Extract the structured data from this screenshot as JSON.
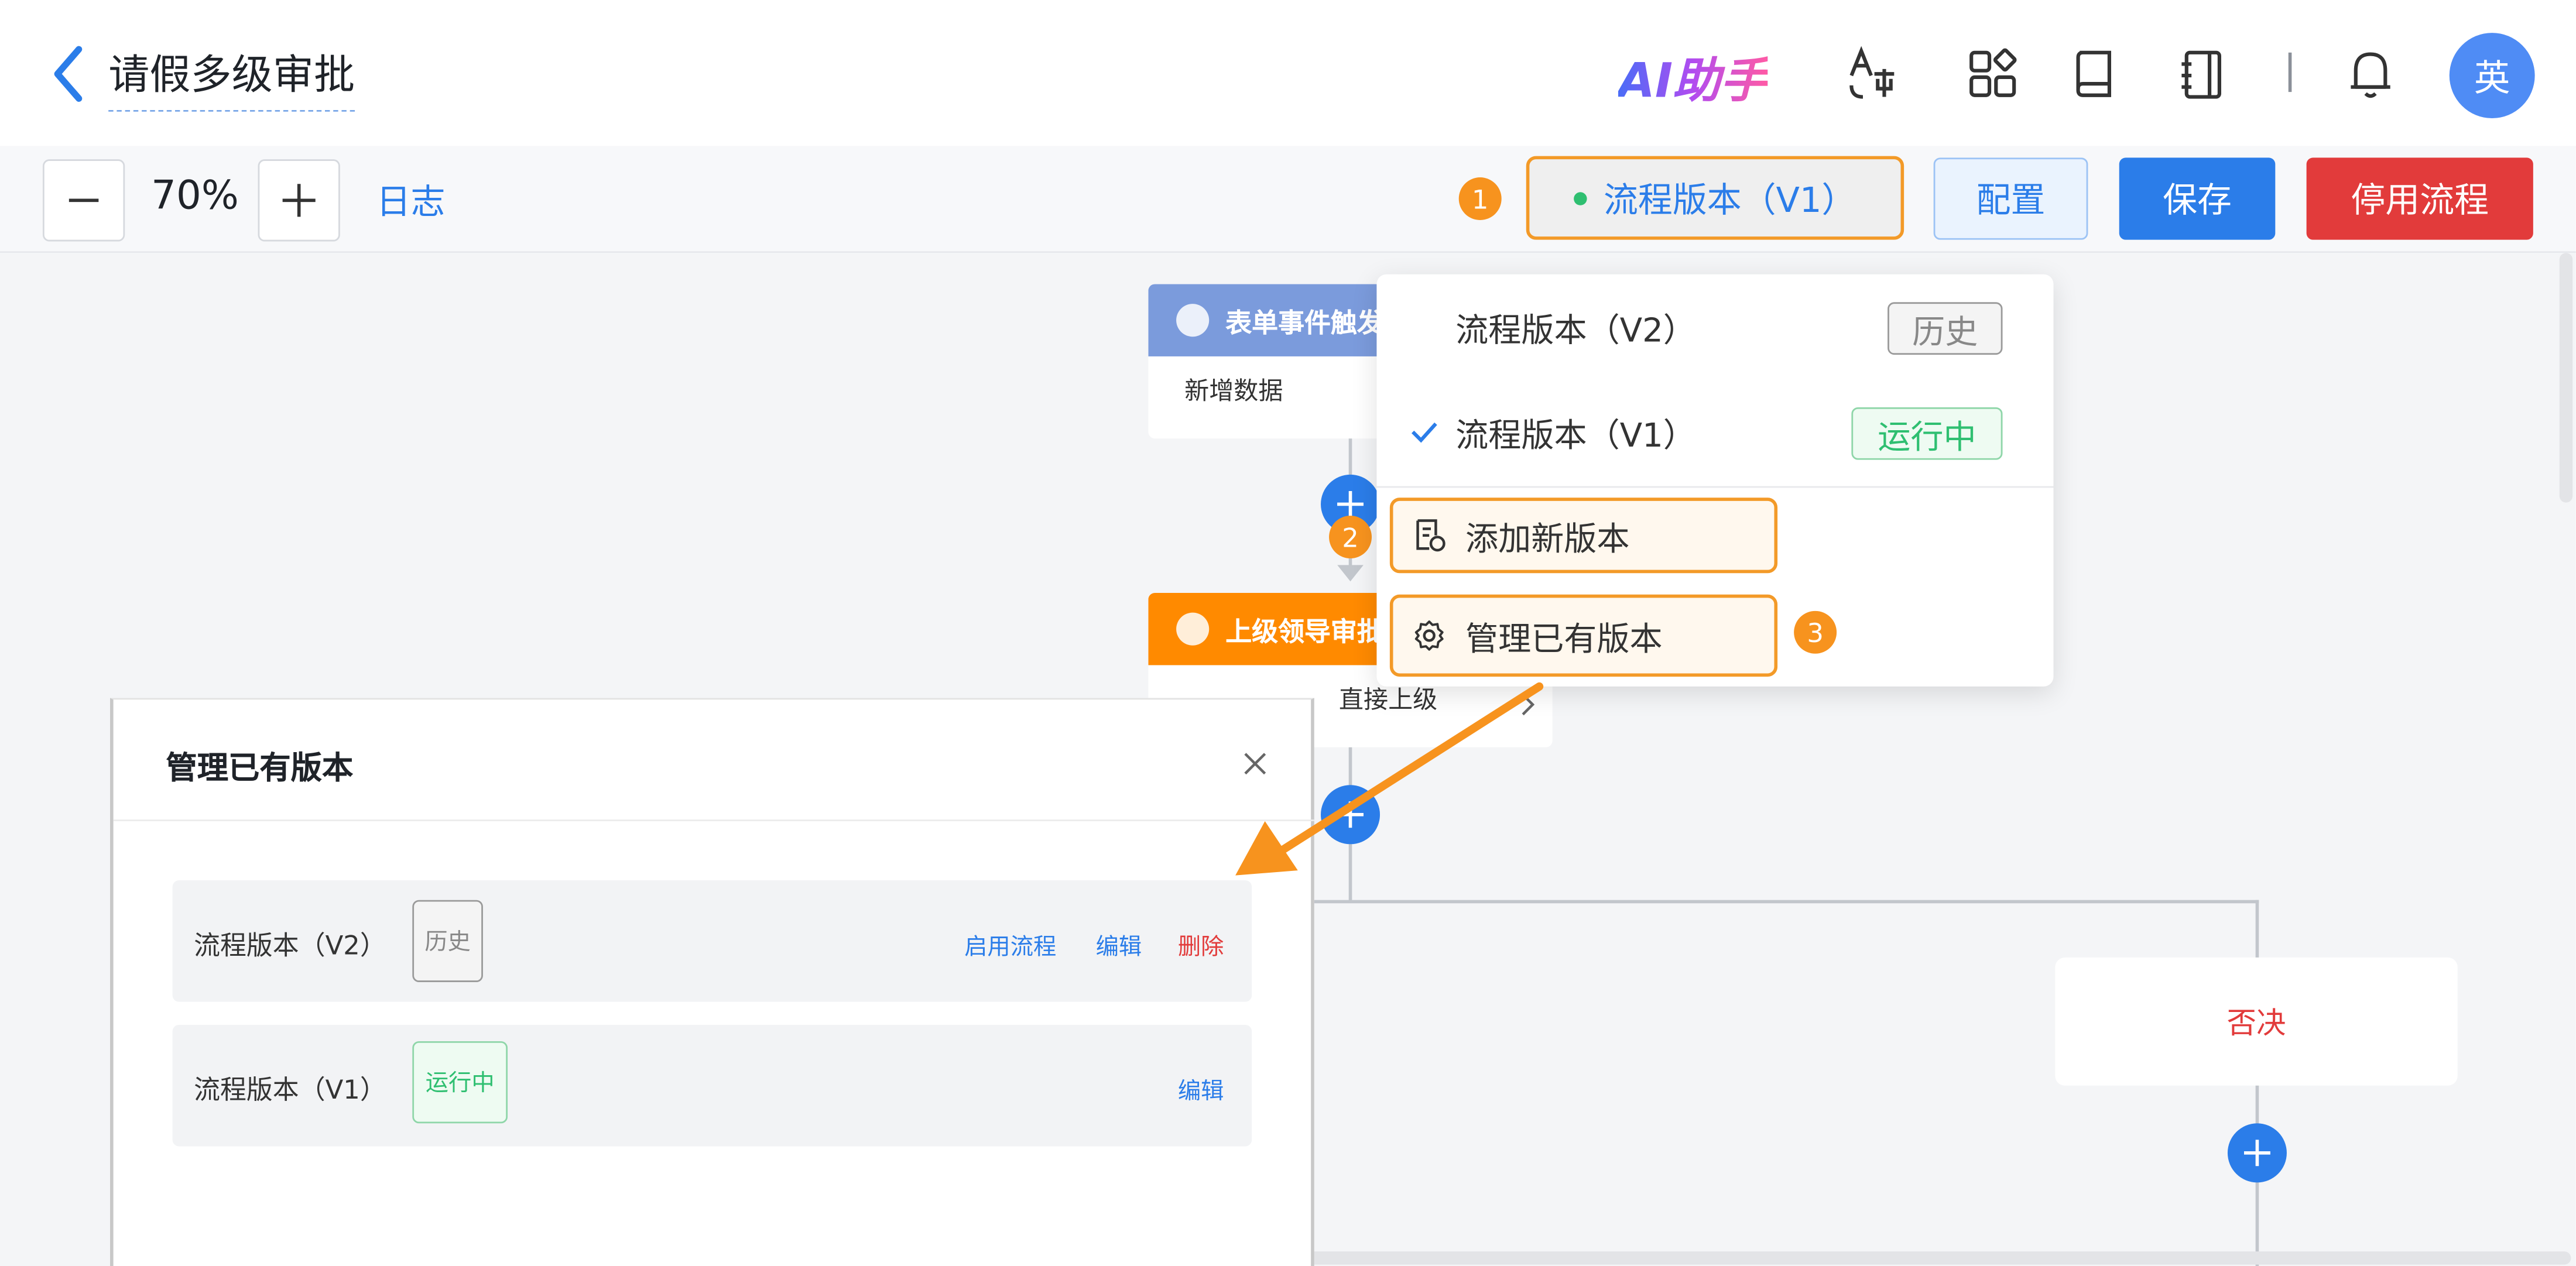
{
  "header": {
    "title": "请假多级审批",
    "ai_assistant": "AI助手",
    "avatar_text": "英"
  },
  "toolbar": {
    "zoom_value": "70%",
    "log_label": "日志",
    "version_button": "流程版本（V1）",
    "config_label": "配置",
    "save_label": "保存",
    "stop_label": "停用流程"
  },
  "callouts": [
    "1",
    "2",
    "3"
  ],
  "flow": {
    "trigger_node": {
      "title": "表单事件触发",
      "body": "新增数据"
    },
    "approval_node": {
      "title": "上级领导审批",
      "body": "直接上级"
    },
    "reject_node": "否决"
  },
  "version_menu": {
    "items": [
      {
        "label": "流程版本（V2）",
        "tag": "历史",
        "selected": false
      },
      {
        "label": "流程版本（V1）",
        "tag": "运行中",
        "selected": true
      }
    ],
    "add_version": "添加新版本",
    "manage_versions": "管理已有版本"
  },
  "manage_modal": {
    "title": "管理已有版本",
    "rows": [
      {
        "label": "流程版本（V2）",
        "tag": "历史",
        "actions": [
          "启用流程",
          "编辑",
          "删除"
        ]
      },
      {
        "label": "流程版本（V1）",
        "tag": "运行中",
        "actions": [
          "编辑"
        ]
      }
    ]
  },
  "colors": {
    "primary": "#2b7de9",
    "danger": "#e23b3b",
    "callout": "#f7931e",
    "running": "#2fbf71",
    "trigger_header": "#7b9bdc",
    "approval_header": "#ff8a00"
  }
}
